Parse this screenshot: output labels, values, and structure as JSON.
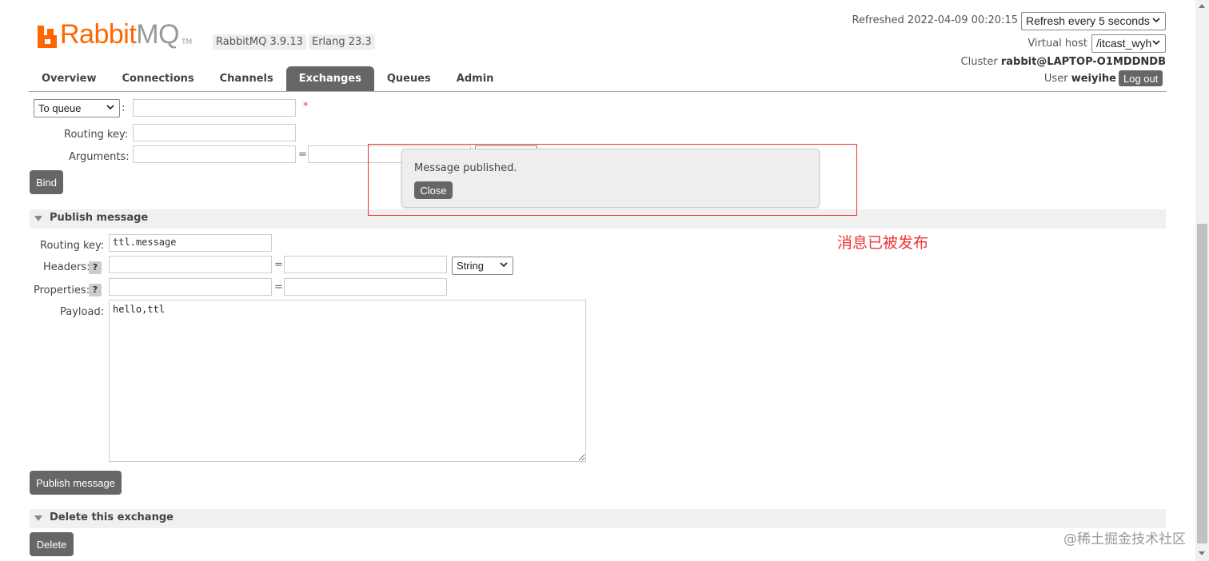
{
  "header": {
    "brand_rabbit": "Rabbit",
    "brand_mq": "MQ",
    "brand_tm": "TM",
    "version": "RabbitMQ 3.9.13",
    "erlang": "Erlang 23.3",
    "refreshed": "Refreshed 2022-04-09 00:20:15",
    "refresh_select": "Refresh every 5 seconds",
    "vhost_label": "Virtual host",
    "vhost_select": "/itcast_wyh",
    "cluster_label": "Cluster",
    "cluster_name": "rabbit@LAPTOP-O1MDDNDB",
    "user_label": "User",
    "user_name": "weiyihe",
    "logout": "Log out"
  },
  "tabs": [
    "Overview",
    "Connections",
    "Channels",
    "Exchanges",
    "Queues",
    "Admin"
  ],
  "active_tab": "Exchanges",
  "bind_form": {
    "destination_select": "To queue",
    "destination_value": "",
    "routing_key_label": "Routing key:",
    "routing_key_value": "",
    "arguments_label": "Arguments:",
    "required_mark": "*",
    "eq": "=",
    "bind_button": "Bind"
  },
  "publish": {
    "section_title": "Publish message",
    "routing_key_label": "Routing key:",
    "routing_key_value": "ttl.message",
    "headers_label": "Headers:",
    "help": "?",
    "headers_type": "String",
    "properties_label": "Properties:",
    "payload_label": "Payload:",
    "payload_value": "hello,ttl",
    "publish_button": "Publish message"
  },
  "delete": {
    "section_title": "Delete this exchange",
    "delete_button": "Delete"
  },
  "popup": {
    "message": "Message published.",
    "close_button": "Close"
  },
  "annotation": "消息已被发布",
  "watermark": "@稀土掘金技术社区",
  "colors": {
    "brand_orange": "#ff6600",
    "tab_active": "#666666",
    "annotation_red": "#ee3333"
  }
}
